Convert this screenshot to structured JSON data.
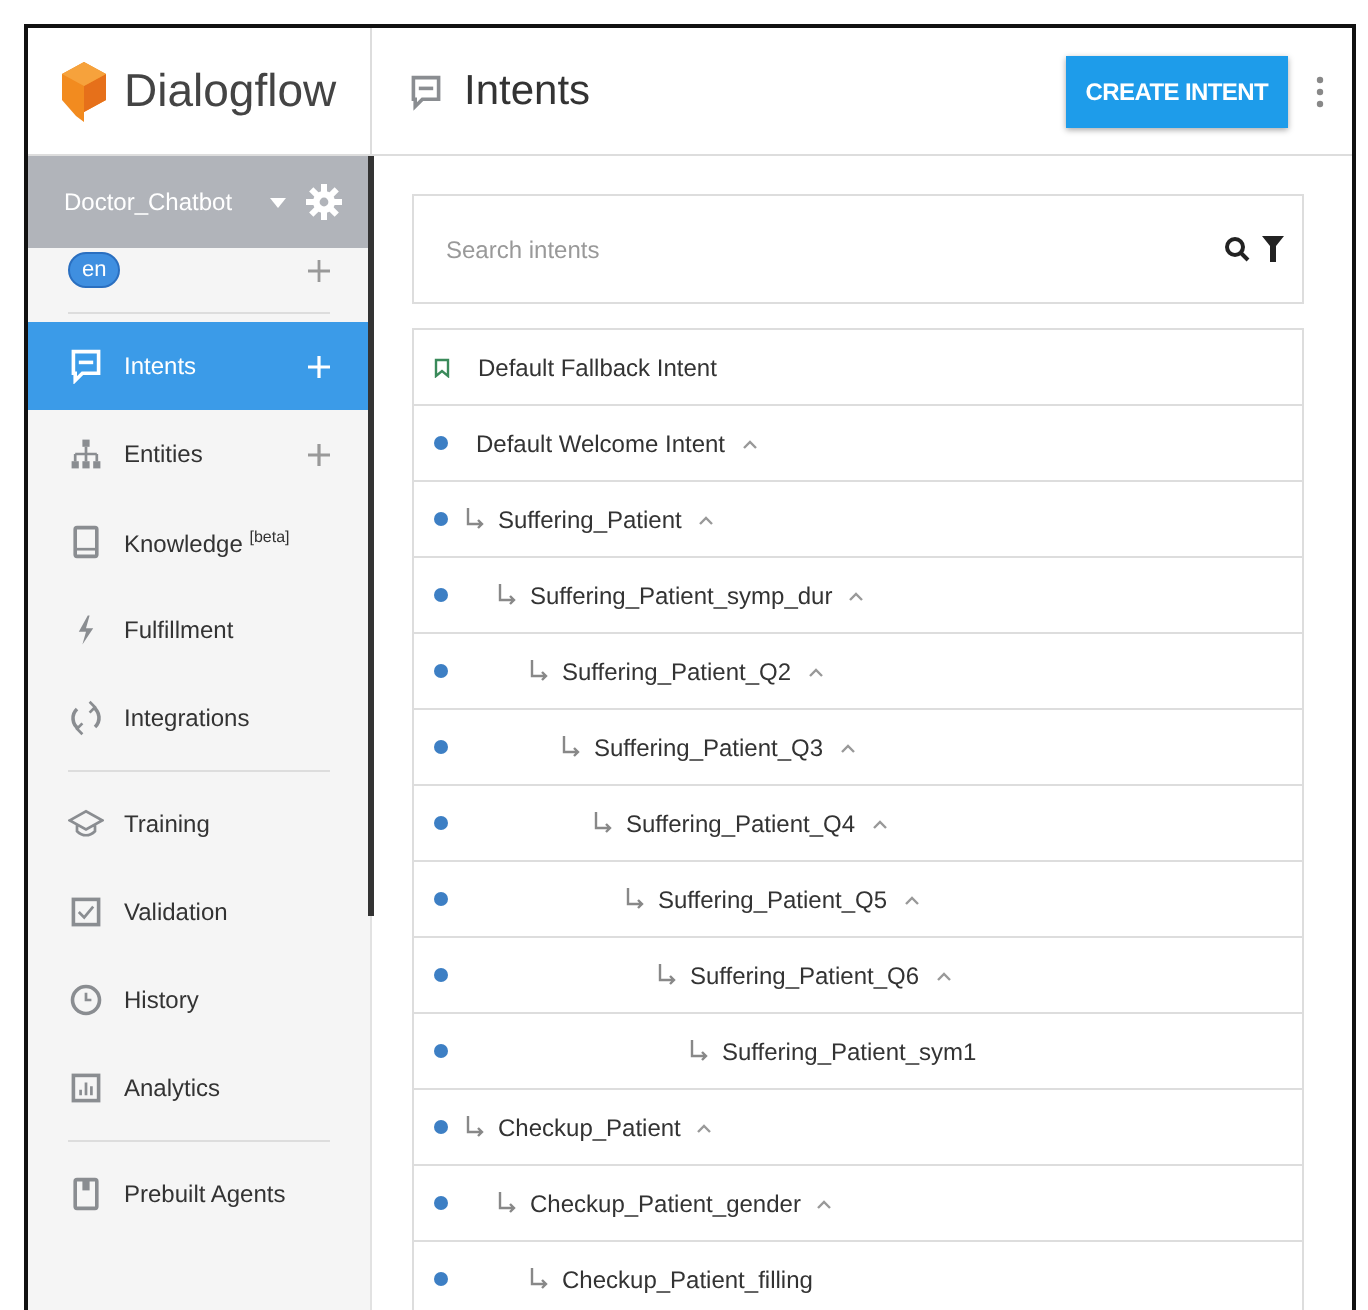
{
  "brand": {
    "name": "Dialogflow"
  },
  "agent": {
    "name": "Doctor_Chatbot",
    "language": "en"
  },
  "sidebar": {
    "sections": [
      {
        "items": [
          {
            "label": "Intents",
            "selected": true,
            "addable": true
          },
          {
            "label": "Entities",
            "selected": false,
            "addable": true
          },
          {
            "label": "Knowledge $^{[beta]}$",
            "selected": false,
            "addable": false
          },
          {
            "label": "Fulfillment",
            "selected": false,
            "addable": false
          },
          {
            "label": "Integrations",
            "selected": false,
            "addable": false
          }
        ]
      },
      {
        "items": [
          {
            "label": "Training",
            "selected": false,
            "addable": false
          },
          {
            "label": "Validation",
            "selected": false,
            "addable": false
          },
          {
            "label": "History",
            "selected": false,
            "addable": false
          },
          {
            "label": "Analytics",
            "selected": false,
            "addable": false
          }
        ]
      },
      {
        "items": [
          {
            "label": "Prebuilt Agents",
            "selected": false,
            "addable": false
          }
        ]
      }
    ]
  },
  "page": {
    "title": "Intents",
    "primary_button": "CREATE INTENT"
  },
  "search": {
    "placeholder": "Search intents"
  },
  "intents": [
    {
      "name": "Default Fallback Intent",
      "kind": "fallback",
      "expanded": false
    },
    {
      "name": "Default Welcome Intent",
      "kind": "regular",
      "expanded": true,
      "children": [
        {
          "name": "Suffering_Patient",
          "kind": "regular",
          "expanded": true,
          "children": [
            {
              "name": "Suffering_Patient_symp_dur",
              "kind": "regular",
              "expanded": true,
              "children": [
                {
                  "name": "Suffering_Patient_Q2",
                  "kind": "regular",
                  "expanded": true,
                  "children": [
                    {
                      "name": "Suffering_Patient_Q3",
                      "kind": "regular",
                      "expanded": true,
                      "children": [
                        {
                          "name": "Suffering_Patient_Q4",
                          "kind": "regular",
                          "expanded": true,
                          "children": [
                            {
                              "name": "Suffering_Patient_Q5",
                              "kind": "regular",
                              "expanded": true,
                              "children": [
                                {
                                  "name": "Suffering_Patient_Q6",
                                  "kind": "regular",
                                  "expanded": true,
                                  "children": [
                                    {
                                      "name": "Suffering_Patient_sym1",
                                      "kind": "regular",
                                      "expanded": false
                                    }
                                  ]
                                }
                              ]
                            }
                          ]
                        }
                      ]
                    }
                  ]
                }
              ]
            }
          ]
        },
        {
          "name": "Checkup_Patient",
          "kind": "regular",
          "expanded": true,
          "children": [
            {
              "name": "Checkup_Patient_gender",
              "kind": "regular",
              "expanded": true,
              "children": [
                {
                  "name": "Checkup_Patient_filling",
                  "kind": "regular",
                  "expanded": false
                }
              ]
            }
          ]
        }
      ]
    }
  ]
}
